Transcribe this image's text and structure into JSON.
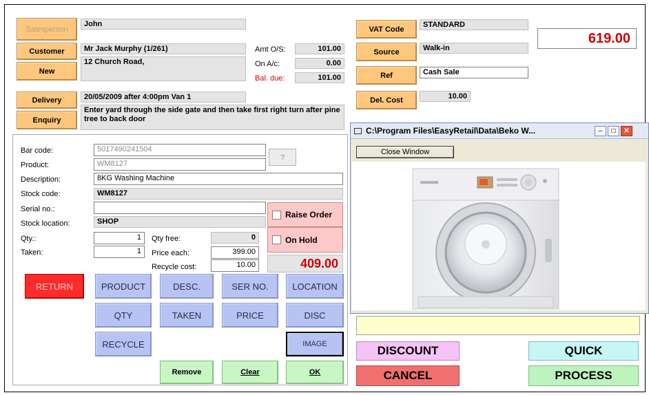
{
  "header": {
    "salesperson_btn": "Salesperson",
    "salesperson_value": "John",
    "customer_btn": "Customer",
    "customer_name": "Mr Jack Murphy (1/261)",
    "new_btn": "New",
    "address": "12 Church Road,",
    "amt_os_label": "Amt O/S:",
    "amt_os_value": "101.00",
    "on_ac_label": "On A/c:",
    "on_ac_value": "0.00",
    "bal_due_label": "Bal. due:",
    "bal_due_value": "101.00",
    "delivery_btn": "Delivery",
    "delivery_value": "20/05/2009 after 4:00pm Van 1",
    "enquiry_btn": "Enquiry",
    "delivery_note": "Enter yard through the side gate and then take first right turn after pine tree to back door",
    "vat_code_btn": "VAT Code",
    "vat_code_value": "STANDARD",
    "total": "619.00",
    "source_btn": "Source",
    "source_value": "Walk-in",
    "ref_btn": "Ref",
    "ref_value": "Cash Sale",
    "del_cost_btn": "Del. Cost",
    "del_cost_value": "10.00"
  },
  "item": {
    "barcode_label": "Bar code:",
    "barcode_value": "5017490241504",
    "question_btn": "?",
    "product_label": "Product:",
    "product_value": "WM8127",
    "description_label": "Description:",
    "description_value": "8KG Washing Machine",
    "stock_code_label": "Stock code:",
    "stock_code_value": "WM8127",
    "serial_label": "Serial no.:",
    "serial_value": "",
    "stock_location_label": "Stock location:",
    "stock_location_value": "SHOP",
    "qty_label": "Qty.:",
    "qty_value": "1",
    "qty_free_label": "Qty free:",
    "qty_free_value": "0",
    "taken_label": "Taken:",
    "taken_value": "1",
    "price_each_label": "Price each:",
    "price_each_value": "399.00",
    "recycle_label": "Recycle cost:",
    "recycle_value": "10.00",
    "raise_order_label": "Raise Order",
    "on_hold_label": "On Hold",
    "line_total": "409.00"
  },
  "buttons": {
    "return": "RETURN",
    "product": "PRODUCT",
    "desc": "DESC.",
    "ser_no": "SER NO.",
    "location": "LOCATION",
    "qty": "QTY",
    "taken": "TAKEN",
    "price": "PRICE",
    "disc": "DISC",
    "recycle": "RECYCLE",
    "image": "IMAGE",
    "remove": "Remove",
    "clear": "Clear",
    "ok": "OK",
    "discount": "DISCOUNT",
    "quick": "QUICK",
    "cancel": "CANCEL",
    "process": "PROCESS"
  },
  "image_window": {
    "title": "C:\\Program Files\\EasyRetail\\Data\\Beko W...",
    "close_btn": "Close Window"
  },
  "colors": {
    "total_red": "#d40000",
    "orange_button": "#ffc77d",
    "blue_button": "#b7c3f4",
    "green_button": "#c9f6c5",
    "return_red": "#ff2a2a",
    "discount_pink": "#f6c3f6",
    "quick_cyan": "#c6f6f6",
    "cancel_red": "#f07070",
    "process_green": "#bdf3bd",
    "note_yellow": "#ffffcc"
  }
}
